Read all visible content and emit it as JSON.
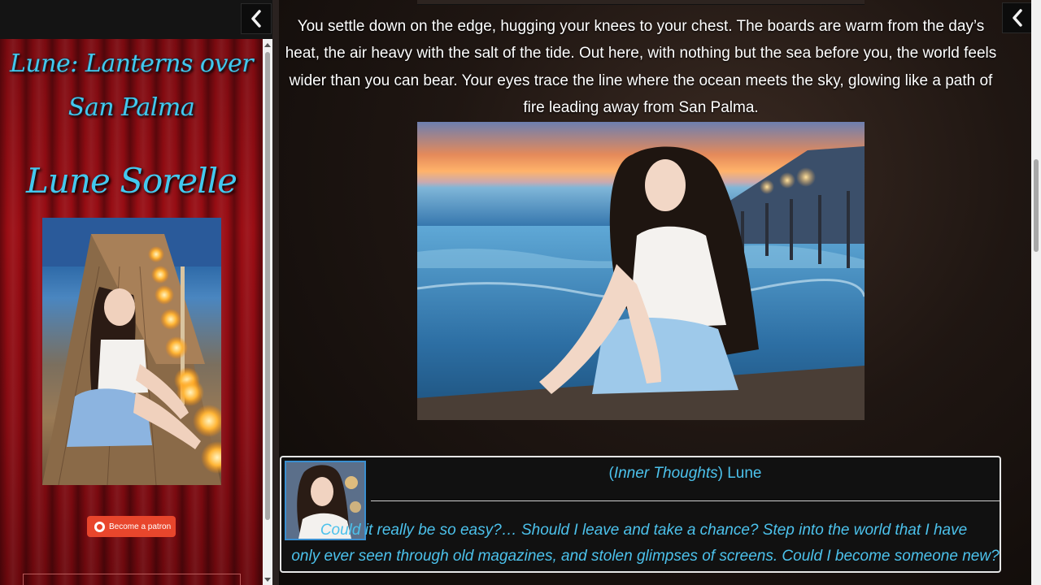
{
  "sidebar": {
    "story_title_line1": "Lune: Lanterns over",
    "story_title_line2": "San Palma",
    "character_name": "Lune Sorelle",
    "patron_button_label": "Become a patron"
  },
  "icons": {
    "collapse": "chevron-left-icon",
    "patreon": "patreon-icon"
  },
  "story": {
    "paragraph": "You settle down on the edge, hugging your knees to your chest. The boards are warm from the day’s heat, the air heavy with the salt of the tide. Out here, with nothing but the sea before you, the world feels wider than you can bear. Your eyes trace the line where the ocean meets the sky, glowing like a path of fire leading away from San Palma."
  },
  "thought": {
    "open_paren": "(",
    "label": "Inner Thoughts",
    "close_paren": ")",
    "speaker": "Lune",
    "line1": "Could it really be so easy?… Should I leave and take a chance? Step into the world that I have",
    "line2": "only ever seen through old magazines, and stolen glimpses of screens. Could I become someone new?"
  },
  "colors": {
    "accent": "#43c8ee",
    "thought_text": "#4cc2ec",
    "curtain": "#8a0c12",
    "patron": "#e8462c"
  }
}
